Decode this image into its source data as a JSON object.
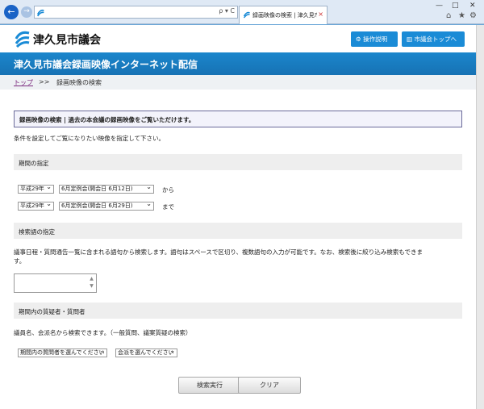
{
  "browser": {
    "tab_title": "録画映像の検索 | 津久見市...",
    "tab_close": "×",
    "address_tools": "ρ ▾ C",
    "window_controls": {
      "minimize": "—",
      "maximize": "□",
      "close": "✕"
    },
    "toolbar_icons": {
      "home": "⌂",
      "favorites": "★",
      "settings": "⚙"
    }
  },
  "header": {
    "site_name": "津久見市議会",
    "manual_button": "操作説明",
    "council_top_button": "市議会トップへ"
  },
  "page_title": "津久見市議会録画映像インターネット配信",
  "breadcrumb": {
    "top": "トップ",
    "separator": ">>",
    "current": "録画映像の検索"
  },
  "intro": {
    "box_text": "録画映像の検索 | 過去の本会議の録画映像をご覧いただけます。",
    "instructions": "条件を設定してご覧になりたい映像を指定して下さい。"
  },
  "period": {
    "heading": "期間の指定",
    "from": {
      "era": "平成29年",
      "session": "6月定例会(開会日 6月12日)",
      "suffix": "から"
    },
    "to": {
      "era": "平成29年",
      "session": "6月定例会(開会日 6月29日)",
      "suffix": "まで"
    }
  },
  "keyword": {
    "heading": "検索語の指定",
    "description_line1": "議事日程・質問通告一覧に含まれる語句から検索します。語句はスペースで区切り、複数語句の入力が可能です。なお、検索後に絞り込み検索もできま",
    "description_line2": "す。",
    "input_value": ""
  },
  "questioner": {
    "heading": "期間内の質疑者・質問者",
    "description": "議員名、会派名から検索できます。（一般質問、議案質疑の検索）",
    "member_select": "期間内の質問者を選んでください",
    "faction_select": "会派を選んでください"
  },
  "actions": {
    "search": "検索実行",
    "clear": "クリア"
  },
  "colors": {
    "brand_blue": "#1b86cc",
    "button_blue": "#1a8bd6",
    "link_purple": "#7b2a7e"
  }
}
